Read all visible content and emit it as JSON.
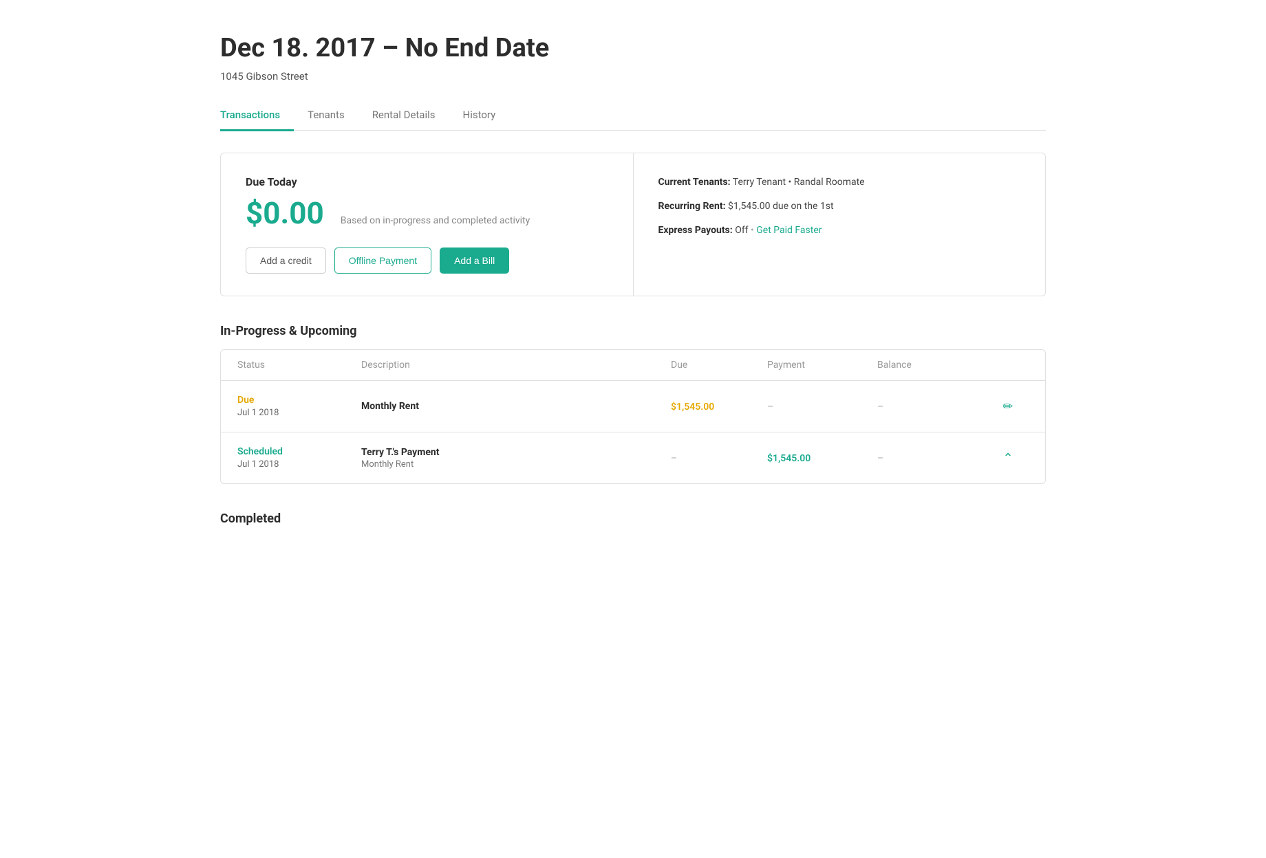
{
  "page": {
    "title": "Dec 18. 2017 – No End Date",
    "subtitle": "1045 Gibson Street"
  },
  "tabs": [
    {
      "id": "transactions",
      "label": "Transactions",
      "active": true
    },
    {
      "id": "tenants",
      "label": "Tenants",
      "active": false
    },
    {
      "id": "rental-details",
      "label": "Rental Details",
      "active": false
    },
    {
      "id": "history",
      "label": "History",
      "active": false
    }
  ],
  "summary": {
    "due_today_label": "Due Today",
    "due_amount": "$0.00",
    "due_note": "Based on in-progress and completed activity",
    "buttons": {
      "add_credit": "Add a credit",
      "offline_payment": "Offline Payment",
      "add_bill": "Add a Bill"
    },
    "right": {
      "current_tenants_label": "Current Tenants:",
      "current_tenants_value": "Terry Tenant • Randal Roomate",
      "recurring_rent_label": "Recurring Rent:",
      "recurring_rent_value": "$1,545.00 due on the 1st",
      "express_payouts_label": "Express Payouts:",
      "express_payouts_status": "Off",
      "express_payouts_link": "Get Paid Faster"
    }
  },
  "in_progress": {
    "section_title": "In-Progress & Upcoming",
    "columns": {
      "status": "Status",
      "description": "Description",
      "due": "Due",
      "payment": "Payment",
      "balance": "Balance"
    },
    "rows": [
      {
        "status": "Due",
        "date": "Jul 1 2018",
        "description_main": "Monthly Rent",
        "description_sub": "",
        "due_amount": "$1,545.00",
        "payment": "–",
        "balance": "–",
        "action": "edit"
      },
      {
        "status": "Scheduled",
        "date": "Jul 1 2018",
        "description_main": "Terry T.'s Payment",
        "description_sub": "Monthly Rent",
        "due_amount": "–",
        "payment": "$1,545.00",
        "balance": "–",
        "action": "chevron"
      }
    ]
  },
  "completed": {
    "section_title": "Completed"
  }
}
